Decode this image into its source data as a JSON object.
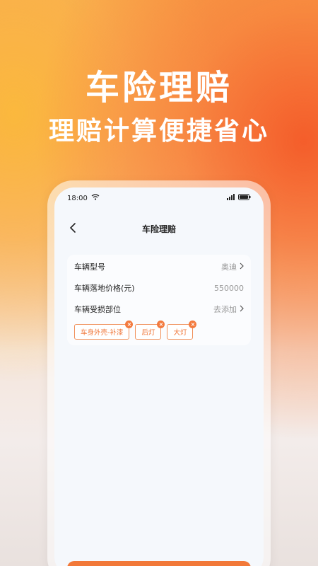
{
  "hero": {
    "title": "车险理赔",
    "subtitle": "理赔计算便捷省心"
  },
  "status_bar": {
    "time": "18:00",
    "icons": [
      "wifi-icon",
      "signal-icon",
      "battery-icon"
    ]
  },
  "nav": {
    "title": "车险理赔",
    "back_icon": "chevron-left-icon"
  },
  "form": {
    "rows": [
      {
        "label": "车辆型号",
        "value": "奥迪",
        "has_arrow": true
      },
      {
        "label": "车辆落地价格(元)",
        "value": "550000",
        "has_arrow": false
      },
      {
        "label": "车辆受损部位",
        "value": "去添加",
        "has_arrow": true
      }
    ],
    "damage_tags": [
      {
        "label": "车身外壳-补漆"
      },
      {
        "label": "后灯"
      },
      {
        "label": "大灯"
      }
    ]
  },
  "colors": {
    "accent": "#f27838",
    "tag_border": "#f0905a",
    "tag_text": "#f0773a"
  }
}
